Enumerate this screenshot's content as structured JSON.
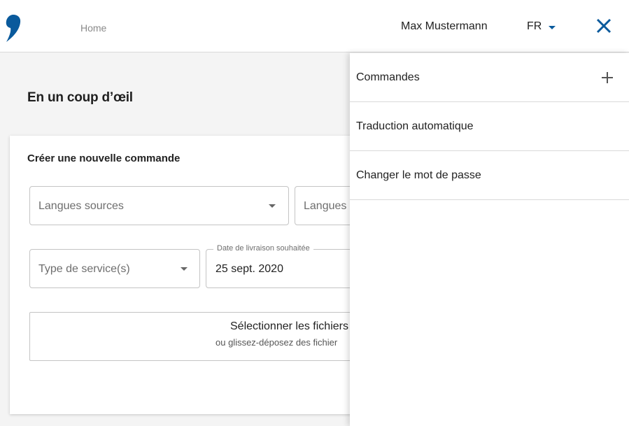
{
  "header": {
    "logo_icon": "brand-comma-logo",
    "home_label": "Home",
    "user_name": "Max Mustermann",
    "language": "FR",
    "close_icon": "close-icon",
    "accent_color": "#0a5a9c"
  },
  "main": {
    "title": "En un coup d’œil",
    "card": {
      "title": "Créer une nouvelle commande",
      "source_languages_placeholder": "Langues sources",
      "target_languages_placeholder": "Langues c",
      "service_type_placeholder": "Type de service(s)",
      "delivery_date_label": "Date de livraison souhaitée",
      "delivery_date_value": "25 sept. 2020",
      "dropzone_title": "Sélectionner les fichiers",
      "dropzone_subtitle": "ou glissez-déposez des fichier"
    }
  },
  "side_panel": {
    "items": [
      {
        "label": "Commandes",
        "icon": "plus-icon"
      },
      {
        "label": "Traduction automatique"
      },
      {
        "label": "Changer le mot de passe"
      }
    ]
  }
}
